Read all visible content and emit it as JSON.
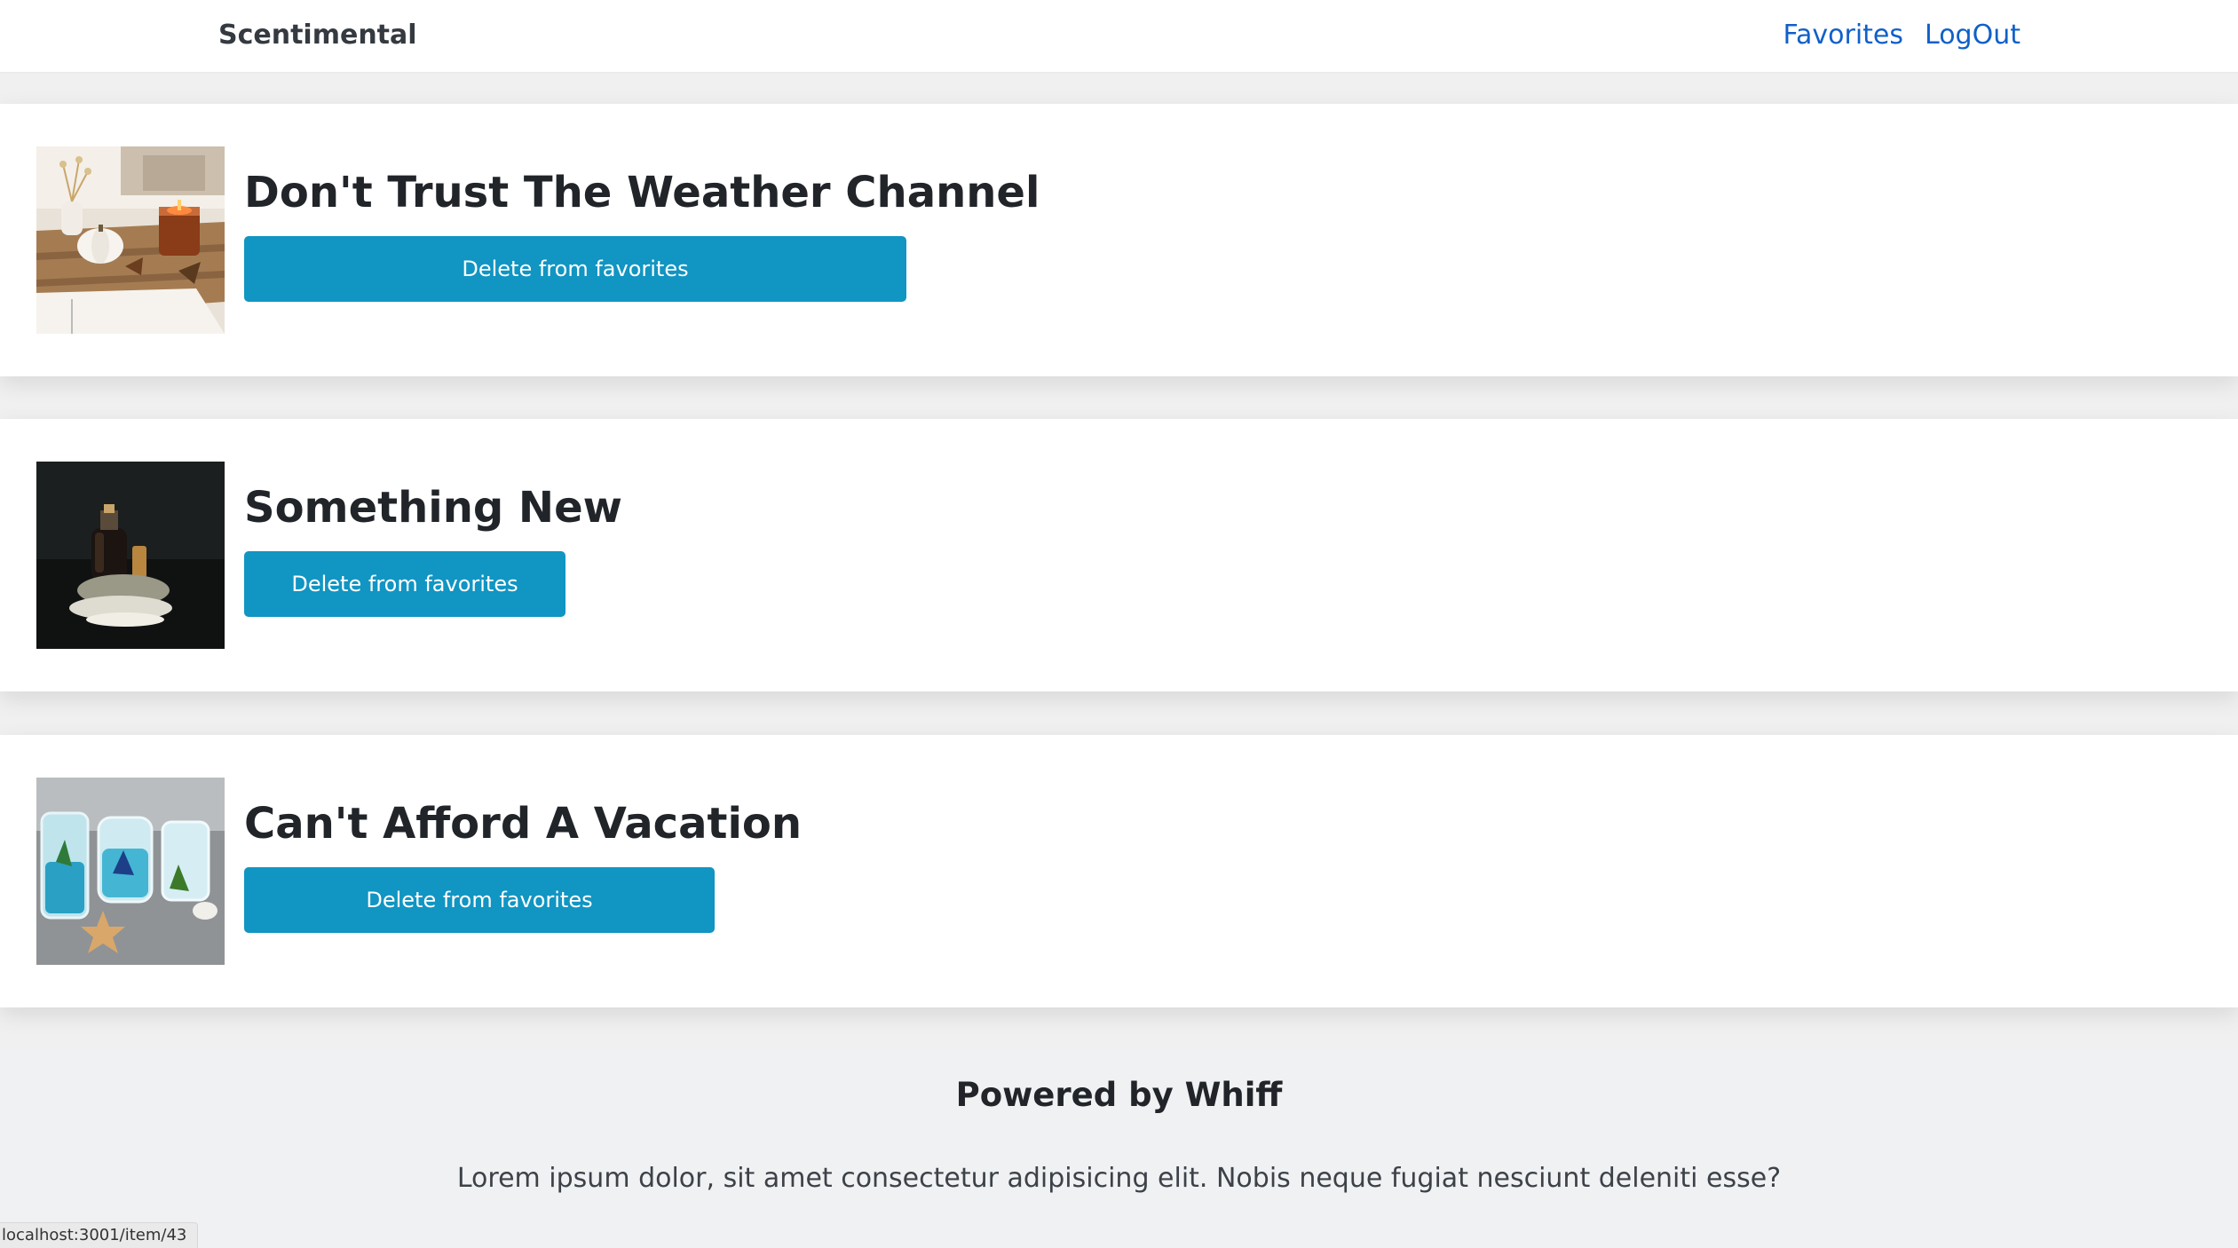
{
  "navbar": {
    "brand": "Scentimental",
    "links": [
      "Favorites",
      "LogOut"
    ]
  },
  "favorites": [
    {
      "title": "Don't Trust The Weather Channel",
      "button_label": "Delete from favorites",
      "image": "autumn-candle-pumpkin-tray-photo"
    },
    {
      "title": "Something New",
      "button_label": "Delete from favorites",
      "image": "perfume-bottle-on-stones-photo"
    },
    {
      "title": "Can't Afford A Vacation",
      "button_label": "Delete from favorites",
      "image": "ocean-gel-candles-starfish-photo"
    }
  ],
  "footer": {
    "title": "Powered by Whiff",
    "text": "Lorem ipsum dolor, sit amet consectetur adipisicing elit. Nobis neque fugiat nesciunt deleniti esse?"
  },
  "status_bar": {
    "url": "localhost:3001/item/43"
  },
  "colors": {
    "button": "#1195c2",
    "link": "#1060c9",
    "footer_bg": "#f0f1f3"
  }
}
